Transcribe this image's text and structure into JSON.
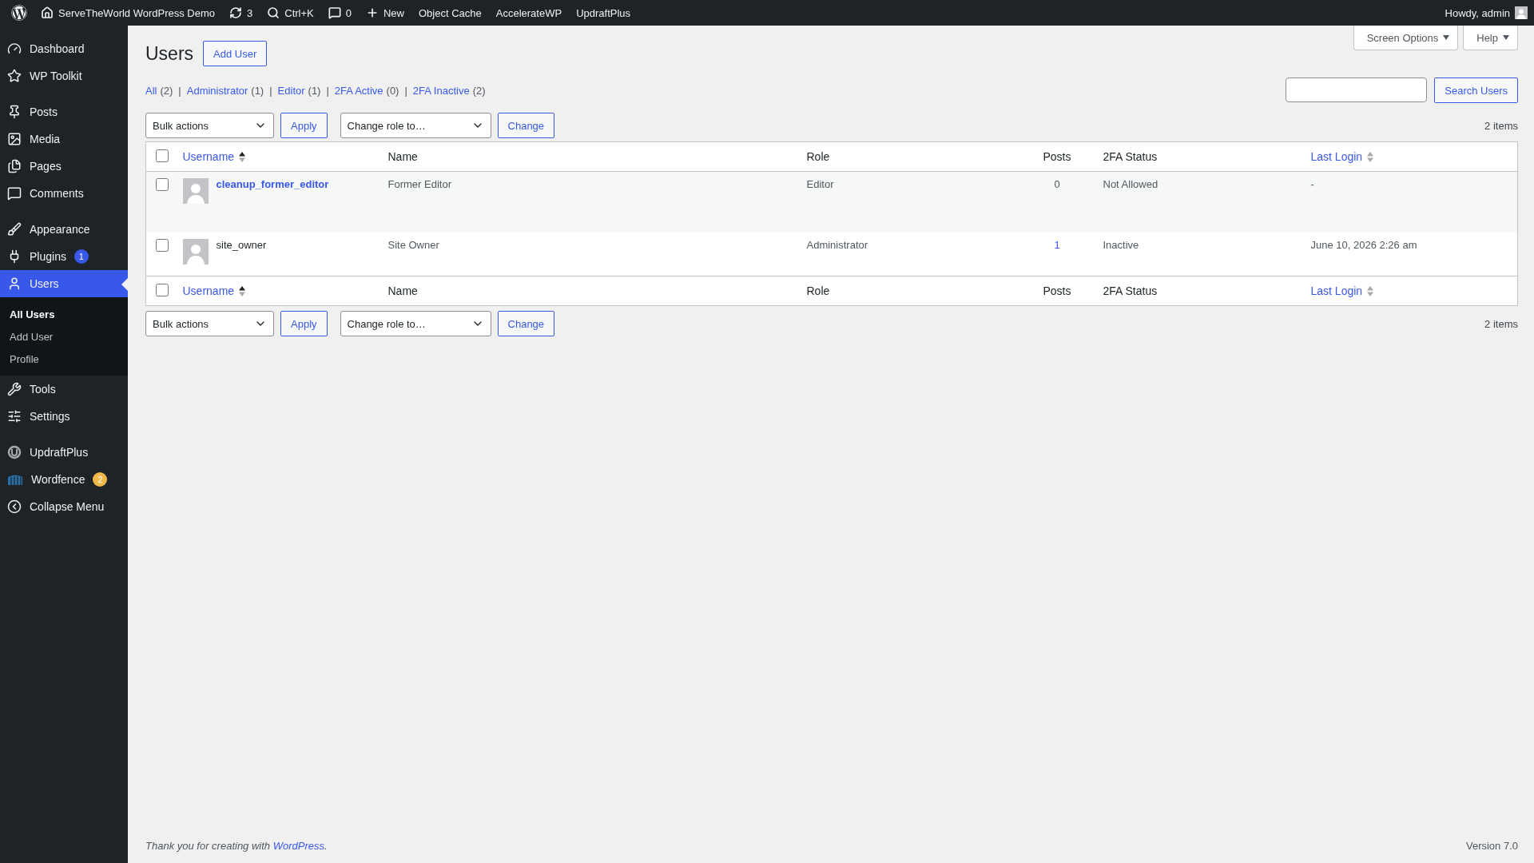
{
  "admin_bar": {
    "items": [
      {
        "label": "ServeTheWorld WordPress Demo"
      },
      {
        "label": "3"
      },
      {
        "label": "Ctrl+K"
      },
      {
        "label": "0"
      },
      {
        "label": "New"
      },
      {
        "label": "Object Cache"
      },
      {
        "label": "AccelerateWP"
      },
      {
        "label": "UpdraftPlus"
      }
    ],
    "account": "Howdy, admin"
  },
  "sidebar": {
    "groups": [
      {
        "items": [
          {
            "label": "Dashboard",
            "selected": false
          },
          {
            "label": "WP Toolkit",
            "selected": false
          }
        ]
      },
      {
        "items": [
          {
            "label": "Posts",
            "selected": false
          },
          {
            "label": "Media",
            "selected": false
          },
          {
            "label": "Pages",
            "selected": false
          },
          {
            "label": "Comments",
            "selected": false
          }
        ]
      },
      {
        "items": [
          {
            "label": "Appearance",
            "selected": false
          },
          {
            "label": "Plugins",
            "selected": false,
            "badge": "1",
            "color": "#3858e9"
          },
          {
            "label": "Users",
            "selected": true,
            "children": [
              {
                "label": "All Users",
                "selected": true
              },
              {
                "label": "Add User",
                "selected": false
              },
              {
                "label": "Profile",
                "selected": false
              }
            ]
          },
          {
            "label": "Tools",
            "selected": false
          },
          {
            "label": "Settings",
            "selected": false
          }
        ]
      },
      {
        "items": [
          {
            "label": "UpdraftPlus",
            "selected": false
          },
          {
            "label": "Wordfence",
            "selected": false,
            "badge": "2",
            "color": "#f0b849"
          },
          {
            "label": "Collapse Menu",
            "selected": false
          }
        ]
      }
    ]
  },
  "screen_tabs": [
    "Screen Options",
    "Help"
  ],
  "page": {
    "title": "Users",
    "add_button": "Add User"
  },
  "filters": [
    {
      "label": "All",
      "count": "(2)"
    },
    {
      "separator": "|",
      "label": "Administrator",
      "count": "(1)"
    },
    {
      "separator": "|",
      "label": "Editor",
      "count": "(1)"
    },
    {
      "separator": "|",
      "label": "2FA Active",
      "count": "(0)"
    },
    {
      "separator": "|",
      "label": "2FA Inactive",
      "count": "(2)"
    }
  ],
  "search": {
    "button": "Search Users"
  },
  "toolbars": [
    {
      "bulk": "Bulk actions",
      "apply": "Apply",
      "role": "Change role to…",
      "change": "Change",
      "count": "2 items"
    },
    {
      "bulk": "Bulk actions",
      "apply": "Apply",
      "role": "Change role to…",
      "change": "Change",
      "count": "2 items"
    }
  ],
  "table": {
    "header": {
      "select_all": false,
      "columns": [
        {
          "label": "Username",
          "sortable": true
        },
        {
          "label": "Name",
          "sortable": false
        },
        {
          "label": "Role",
          "sortable": false
        },
        {
          "label": "Posts",
          "sortable": false
        },
        {
          "label": "2FA Status",
          "sortable": false
        },
        {
          "label": "Last Login",
          "sortable": true
        }
      ]
    },
    "footer": {
      "select_all": false,
      "columns": [
        {
          "label": "Username",
          "sortable": true
        },
        {
          "label": "Name",
          "sortable": false
        },
        {
          "label": "Role",
          "sortable": false
        },
        {
          "label": "Posts",
          "sortable": false
        },
        {
          "label": "2FA Status",
          "sortable": false
        },
        {
          "label": "Last Login",
          "sortable": true
        }
      ]
    },
    "rows": [
      {
        "checked": false,
        "username": "cleanup_former_editor",
        "username_linked": true,
        "name": "Former Editor",
        "role": "Editor",
        "posts": "0",
        "posts_linked": false,
        "twofa": "Not Allowed",
        "last_login": "-"
      },
      {
        "checked": false,
        "username": "site_owner",
        "username_linked": false,
        "name": "Site Owner",
        "role": "Administrator",
        "posts": "1",
        "posts_linked": true,
        "twofa": "Inactive",
        "last_login": "June 10, 2026 2:26 am"
      }
    ]
  },
  "footer": {
    "text": "Thank you for creating with ",
    "link": "WordPress",
    "after": ".",
    "version": "Version 7.0"
  }
}
